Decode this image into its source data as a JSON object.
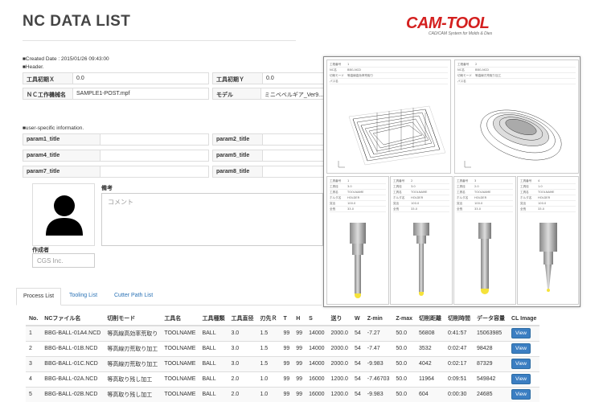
{
  "page": {
    "title": "NC DATA LIST"
  },
  "logo": {
    "main": "CAM-TOOL",
    "sub": "CAD/CAM System for Molds & Dies"
  },
  "header_info": {
    "created": "■Created Date : 2015/01/26 09:43:00",
    "header_label": "■Header.",
    "fields": [
      {
        "key": "工具初期Ｘ",
        "value": "0.0"
      },
      {
        "key": "工具初期Ｙ",
        "value": "0.0"
      },
      {
        "key": "ＮＣ工作機械名",
        "value": "SAMPLE1-POST.mpf"
      },
      {
        "key": "モデル",
        "value": "ミニベベルギア_Ver9..."
      }
    ]
  },
  "user_info": {
    "label": "■user-specific information.",
    "params": [
      "param1_title",
      "param2_title",
      "param4_title",
      "param5_title",
      "param7_title",
      "param8_title"
    ]
  },
  "author": {
    "label": "作成者",
    "value": "CGS Inc."
  },
  "remarks": {
    "label": "備考",
    "placeholder": "コメント"
  },
  "tabs": [
    {
      "label": "Process List",
      "active": true
    },
    {
      "label": "Tooling List",
      "active": false
    },
    {
      "label": "Cutter Path List",
      "active": false
    }
  ],
  "table": {
    "headers": [
      "No.",
      "NCファイル名",
      "切削モード",
      "工具名",
      "工具種類",
      "工具直径",
      "刃先Ｒ",
      "T",
      "H",
      "S",
      "送り",
      "W",
      "Z-min",
      "Z-max",
      "切削距離",
      "切削時間",
      "データ容量",
      "CL Image"
    ],
    "rows": [
      [
        "1",
        "BBG-BALL-01A4.NCD",
        "等高線高効率荒取り",
        "TOOLNAME",
        "BALL",
        "3.0",
        "1.5",
        "99",
        "99",
        "14000",
        "2000.0",
        "54",
        "-7.27",
        "50.0",
        "56808",
        "0:41:57",
        "15063985",
        "View"
      ],
      [
        "2",
        "BBG-BALL-01B.NCD",
        "等高線刃荒取り加工",
        "TOOLNAME",
        "BALL",
        "3.0",
        "1.5",
        "99",
        "99",
        "14000",
        "2000.0",
        "54",
        "-7.47",
        "50.0",
        "3532",
        "0:02:47",
        "98428",
        "View"
      ],
      [
        "3",
        "BBG-BALL-01C.NCD",
        "等高線刃荒取り加工",
        "TOOLNAME",
        "BALL",
        "3.0",
        "1.5",
        "99",
        "99",
        "14000",
        "2000.0",
        "54",
        "-9.983",
        "50.0",
        "4042",
        "0:02:17",
        "87329",
        "View"
      ],
      [
        "4",
        "BBG-BALL-02A.NCD",
        "等高取り残し加工",
        "TOOLNAME",
        "BALL",
        "2.0",
        "1.0",
        "99",
        "99",
        "16000",
        "1200.0",
        "54",
        "-7.46703",
        "50.0",
        "11964",
        "0:09:51",
        "549842",
        "View"
      ],
      [
        "5",
        "BBG-BALL-02B.NCD",
        "等高取り残し加工",
        "TOOLNAME",
        "BALL",
        "2.0",
        "1.0",
        "99",
        "99",
        "16000",
        "1200.0",
        "54",
        "-9.983",
        "50.0",
        "604",
        "0:00:30",
        "24685",
        "View"
      ]
    ]
  },
  "preview": {
    "top_left": {
      "rows": [
        [
          "工程番号",
          "1"
        ],
        [
          "NC名",
          "BBG-NCD"
        ],
        [
          "切削モード",
          "等高線高効率荒取り"
        ],
        [
          "パス名",
          ""
        ]
      ]
    },
    "top_right": {
      "rows": [
        [
          "工程番号",
          "2"
        ],
        [
          "NC名",
          "BBG-NCD"
        ],
        [
          "切削モード",
          "等高線刃荒取り加工"
        ],
        [
          "パス名",
          ""
        ]
      ]
    },
    "tools": [
      {
        "rows": [
          [
            "工具番号",
            "1"
          ],
          [
            "工具径",
            "3.0"
          ],
          [
            "工具名",
            "TOOLNAME"
          ],
          [
            "ホルダ名",
            "HOLDER"
          ],
          [
            "突出",
            "100.0"
          ],
          [
            "全長",
            "33.0"
          ]
        ]
      },
      {
        "rows": [
          [
            "工具番号",
            "2"
          ],
          [
            "工具径",
            "3.0"
          ],
          [
            "工具名",
            "TOOLNAME"
          ],
          [
            "ホルダ名",
            "HOLDER"
          ],
          [
            "突出",
            "100.0"
          ],
          [
            "全長",
            "33.0"
          ]
        ]
      },
      {
        "rows": [
          [
            "工具番号",
            "3"
          ],
          [
            "工具径",
            "2.0"
          ],
          [
            "工具名",
            "TOOLNAME"
          ],
          [
            "ホルダ名",
            "HOLDER"
          ],
          [
            "突出",
            "100.0"
          ],
          [
            "全長",
            "33.0"
          ]
        ]
      },
      {
        "rows": [
          [
            "工具番号",
            "4"
          ],
          [
            "工具径",
            "1.0"
          ],
          [
            "工具名",
            "TOOLNAME"
          ],
          [
            "ホルダ名",
            "HOLDER"
          ],
          [
            "突出",
            "100.0"
          ],
          [
            "全長",
            "33.0"
          ]
        ]
      }
    ]
  },
  "colors": {
    "accent": "#2a72b5",
    "logo_red": "#d4201f",
    "view_button": "#3b7ec2",
    "tool_tip": "#f5e23a"
  }
}
